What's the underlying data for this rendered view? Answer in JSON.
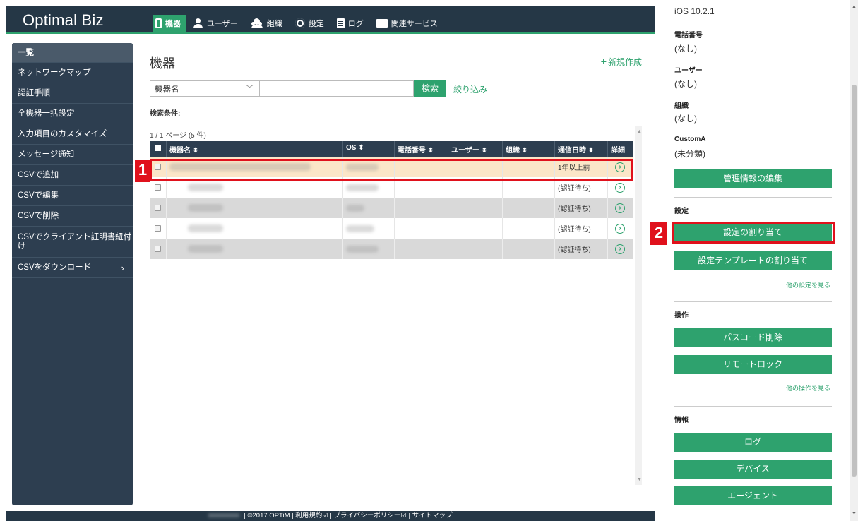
{
  "app": {
    "logo": "Optimal Biz",
    "nav": [
      {
        "label": "機器",
        "icon": "device-icon",
        "active": true
      },
      {
        "label": "ユーザー",
        "icon": "user-icon"
      },
      {
        "label": "組織",
        "icon": "organization-icon"
      },
      {
        "label": "設定",
        "icon": "gear-icon"
      },
      {
        "label": "ログ",
        "icon": "document-icon"
      },
      {
        "label": "関連サービス",
        "icon": "folder-icon"
      }
    ]
  },
  "sidebar": {
    "items": [
      {
        "label": "一覧",
        "active": true
      },
      {
        "label": "ネットワークマップ"
      },
      {
        "label": "認証手順"
      },
      {
        "label": "全機器一括設定"
      },
      {
        "label": "入力項目のカスタマイズ"
      },
      {
        "label": "メッセージ通知"
      },
      {
        "label": "CSVで追加"
      },
      {
        "label": "CSVで編集"
      },
      {
        "label": "CSVで削除"
      },
      {
        "label": "CSVでクライアント証明書紐付け"
      },
      {
        "label": "CSVをダウンロード",
        "arrow": "›"
      }
    ]
  },
  "main": {
    "title": "機器",
    "new_label": "新規作成",
    "new_icon": "plus-icon",
    "search": {
      "field_value": "機器名",
      "chevron": "﹀",
      "query": "",
      "button": "検索",
      "filter_link": "絞り込み"
    },
    "conditions_label": "検索条件:",
    "pager": "1 / 1 ページ (5 件)",
    "table": {
      "headers": [
        "機器名 ⬍",
        "OS ⬍",
        "電話番号 ⬍",
        "ユーザー ⬍",
        "組織 ⬍",
        "通信日時 ⬍",
        "詳細"
      ],
      "rows": [
        {
          "comm": "1年以上前"
        },
        {
          "comm": "(認証待ち)"
        },
        {
          "comm": "(認証待ち)"
        },
        {
          "comm": "(認証待ち)"
        },
        {
          "comm": "(認証待ち)"
        }
      ]
    },
    "markers": [
      "1",
      "2"
    ]
  },
  "details": {
    "os_value": "iOS 10.2.1",
    "phone_label": "電話番号",
    "phone_value": "(なし)",
    "user_label": "ユーザー",
    "user_value": "(なし)",
    "org_label": "組織",
    "org_value": "(なし)",
    "custom_label": "CustomA",
    "custom_value": "(未分類)",
    "edit_button": "管理情報の編集",
    "settings_label": "設定",
    "assign_settings_button": "設定の割り当て",
    "assign_template_button": "設定テンプレートの割り当て",
    "more_settings_link": "他の設定を見る",
    "operations_label": "操作",
    "passcode_delete_button": "パスコード削除",
    "remote_lock_button": "リモートロック",
    "more_operations_link": "他の操作を見る",
    "info_label": "情報",
    "log_button": "ログ",
    "device_button": "デバイス",
    "agent_button": "エージェント"
  },
  "footer": {
    "text": "| ©2017 OPTiM | 利用規約☑ | プライバシーポリシー☑ | サイトマップ"
  },
  "colors": {
    "header_bg": "#253746",
    "accent_green": "#2ea26e",
    "sidebar_bg": "#2d3e50",
    "highlight_row": "#fbe6c8",
    "annotation_red": "#e0111c"
  }
}
